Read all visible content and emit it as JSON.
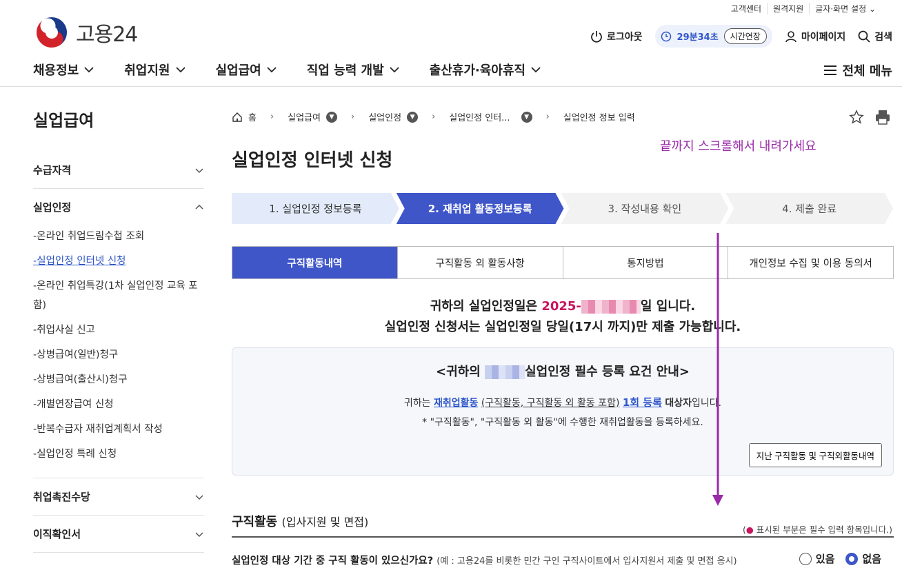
{
  "utility_links": [
    "고객센터",
    "원격지원",
    "글자·화면 설정"
  ],
  "logo_text": "고용24",
  "header": {
    "logout": "로그아웃",
    "timer": "29분34초",
    "extend": "시간연장",
    "mypage": "마이페이지",
    "search": "검색"
  },
  "gnb": [
    "채용정보",
    "취업지원",
    "실업급여",
    "직업 능력 개발",
    "출산휴가·육아휴직"
  ],
  "all_menu": "전체 메뉴",
  "sidebar": {
    "title": "실업급여",
    "sections": [
      {
        "label": "수급자격"
      },
      {
        "label": "실업인정",
        "items": [
          "-온라인 취업드림수첩 조회",
          "-실업인정 인터넷 신청",
          "-온라인 취업특강(1차 실업인정 교육 포함)",
          "-취업사실 신고",
          "-상병급여(일반)청구",
          "-상병급여(출산시)청구",
          "-개별연장급여 신청",
          "-반복수급자 재취업계획서 작성",
          "-실업인정 특례 신청"
        ]
      },
      {
        "label": "취업촉진수당"
      },
      {
        "label": "이직확인서"
      }
    ]
  },
  "breadcrumb": [
    "홈",
    "실업급여",
    "실업인정",
    "실업인정 인터...",
    "실업인정 정보 입력"
  ],
  "page_title": "실업인정 인터넷 신청",
  "scroll_note": "끝까지 스크롤해서 내려가세요",
  "steps": [
    "1. 실업인정 정보등록",
    "2. 재취업 활동정보등록",
    "3. 작성내용 확인",
    "4. 제출 완료"
  ],
  "tabs": [
    "구직활동내역",
    "구직활동 외 활동사항",
    "통지방법",
    "개인정보 수집 및 이용 동의서"
  ],
  "notice": {
    "line1_pre": "귀하의 실업인정일은 ",
    "date_prefix": "2025-",
    "line1_post": "일 입니다.",
    "line2": "실업인정 신청서는 실업인정일 당일(17시 까지)만 제출 가능합니다."
  },
  "box": {
    "title_pre": "<귀하의 ",
    "title_post": "실업인정 필수 등록 요건 안내>",
    "l1_a": "귀하는 ",
    "l1_link": "재취업활동",
    "l1_b": "(구직활동, 구직활동 외 활동 포함)",
    "l1_count": "1회 등록",
    "l1_c": "대상자",
    "l1_d": "입니다.",
    "l2": "* \"구직활동\", \"구직활동 외 활동\"에 수행한 재취업활동을 등록하세요.",
    "button": "지난 구직활동 및 구직외활동내역"
  },
  "section": {
    "title": "구직활동",
    "subtitle": "(입사지원 및 면접)",
    "req_pre": "(",
    "req_dot": "●",
    "req_post": " 표시된 부분은 필수 입력 항목입니다.)"
  },
  "question": {
    "text": "실업인정 대상 기간 중 구직 활동이 있으신가요?",
    "hint": "(예 : 고용24를 비롯한 민간 구인 구직사이트에서 입사지원서 제출 및 면접 응시)",
    "yes": "있음",
    "no": "없음",
    "selected": "없음"
  },
  "colors": {
    "primary": "#3f56c9",
    "accent_pink": "#c8145c",
    "note_purple": "#9a2aa8"
  }
}
